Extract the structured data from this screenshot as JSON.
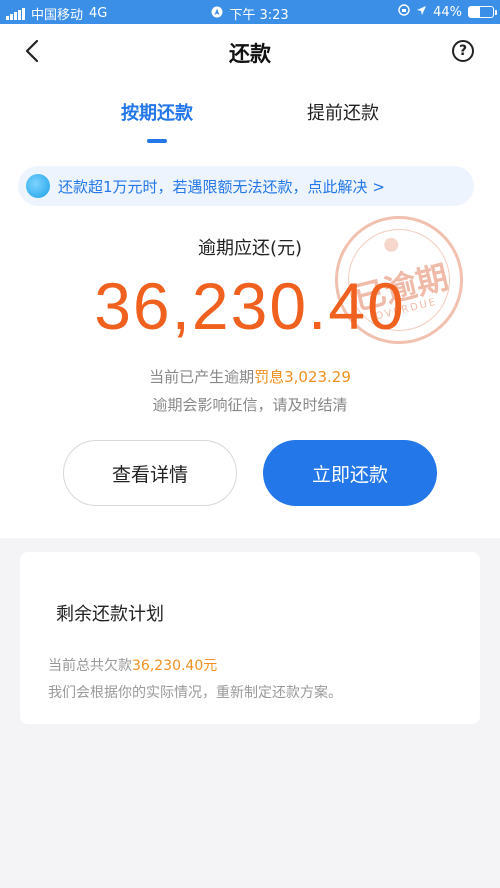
{
  "status_bar": {
    "carrier": "中国移动",
    "network": "4G",
    "time": "下午 3:23",
    "battery": "44%",
    "battery_level": 0.44
  },
  "header": {
    "title": "还款",
    "help_label": "?",
    "tabs": [
      {
        "label": "按期还款",
        "active": true
      },
      {
        "label": "提前还款",
        "active": false
      }
    ]
  },
  "notice": {
    "text": "还款超1万元时，若遇限额无法还款，点此解决 >"
  },
  "overdue": {
    "label": "逾期应还(元)",
    "amount": "36,230.40",
    "stamp_text": "已逾期",
    "stamp_sub": "OVERDUE",
    "penalty_prefix": "当前已产生逾期",
    "penalty_value": "罚息3,023.29",
    "warning": "逾期会影响征信，请及时结清"
  },
  "actions": {
    "details_label": "查看详情",
    "repay_label": "立即还款"
  },
  "plan": {
    "title": "剩余还款计划",
    "total_prefix": "当前总共欠款",
    "total_value": "36,230.40元",
    "note": "我们会根据你的实际情况，重新制定还款方案。"
  },
  "colors": {
    "accent": "#2377e9",
    "amount": "#f0601f",
    "highlight": "#f0901f"
  }
}
